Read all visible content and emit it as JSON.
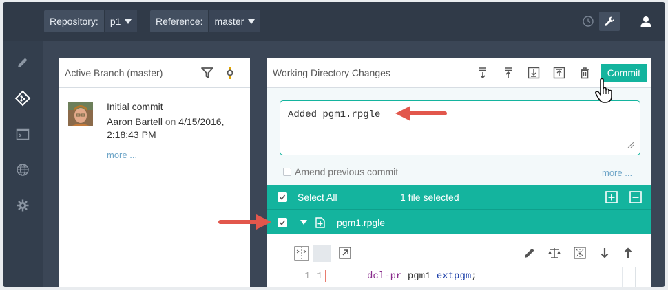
{
  "topbar": {
    "repository_label": "Repository:",
    "repository_value": "p1",
    "reference_label": "Reference:",
    "reference_value": "master"
  },
  "history_panel": {
    "title": "Active Branch (master)",
    "commit": {
      "message": "Initial commit",
      "author": "Aaron Bartell",
      "on_word": "on",
      "date": "4/15/2016,",
      "time": "2:18:43 PM",
      "more_link": "more ..."
    }
  },
  "changes_panel": {
    "title": "Working Directory Changes",
    "commit_button": "Commit",
    "commit_message": "Added pgm1.rpgle",
    "amend_label": "Amend previous commit",
    "more_link": "more ...",
    "select_all_label": "Select All",
    "selected_count": "1 file selected",
    "file_name": "pgm1.rpgle",
    "code": {
      "old_line": "1",
      "new_line": "1",
      "keyword": "dcl-pr",
      "name": "pgm1",
      "extpgm": "extpgm",
      "punct": ";"
    }
  },
  "colors": {
    "accent": "#14b49e",
    "frame": "#3b4656",
    "annotation_arrow": "#e2574c"
  },
  "icons": {
    "rail": [
      "pencil-icon",
      "git-icon",
      "terminal-icon",
      "globe-icon",
      "gear-icon"
    ],
    "topbar": [
      "history-icon",
      "wrench-icon",
      "user-icon"
    ],
    "changes_header": [
      "pull-down-icon",
      "push-up-icon",
      "download-box-icon",
      "upload-box-icon",
      "trash-icon"
    ]
  }
}
